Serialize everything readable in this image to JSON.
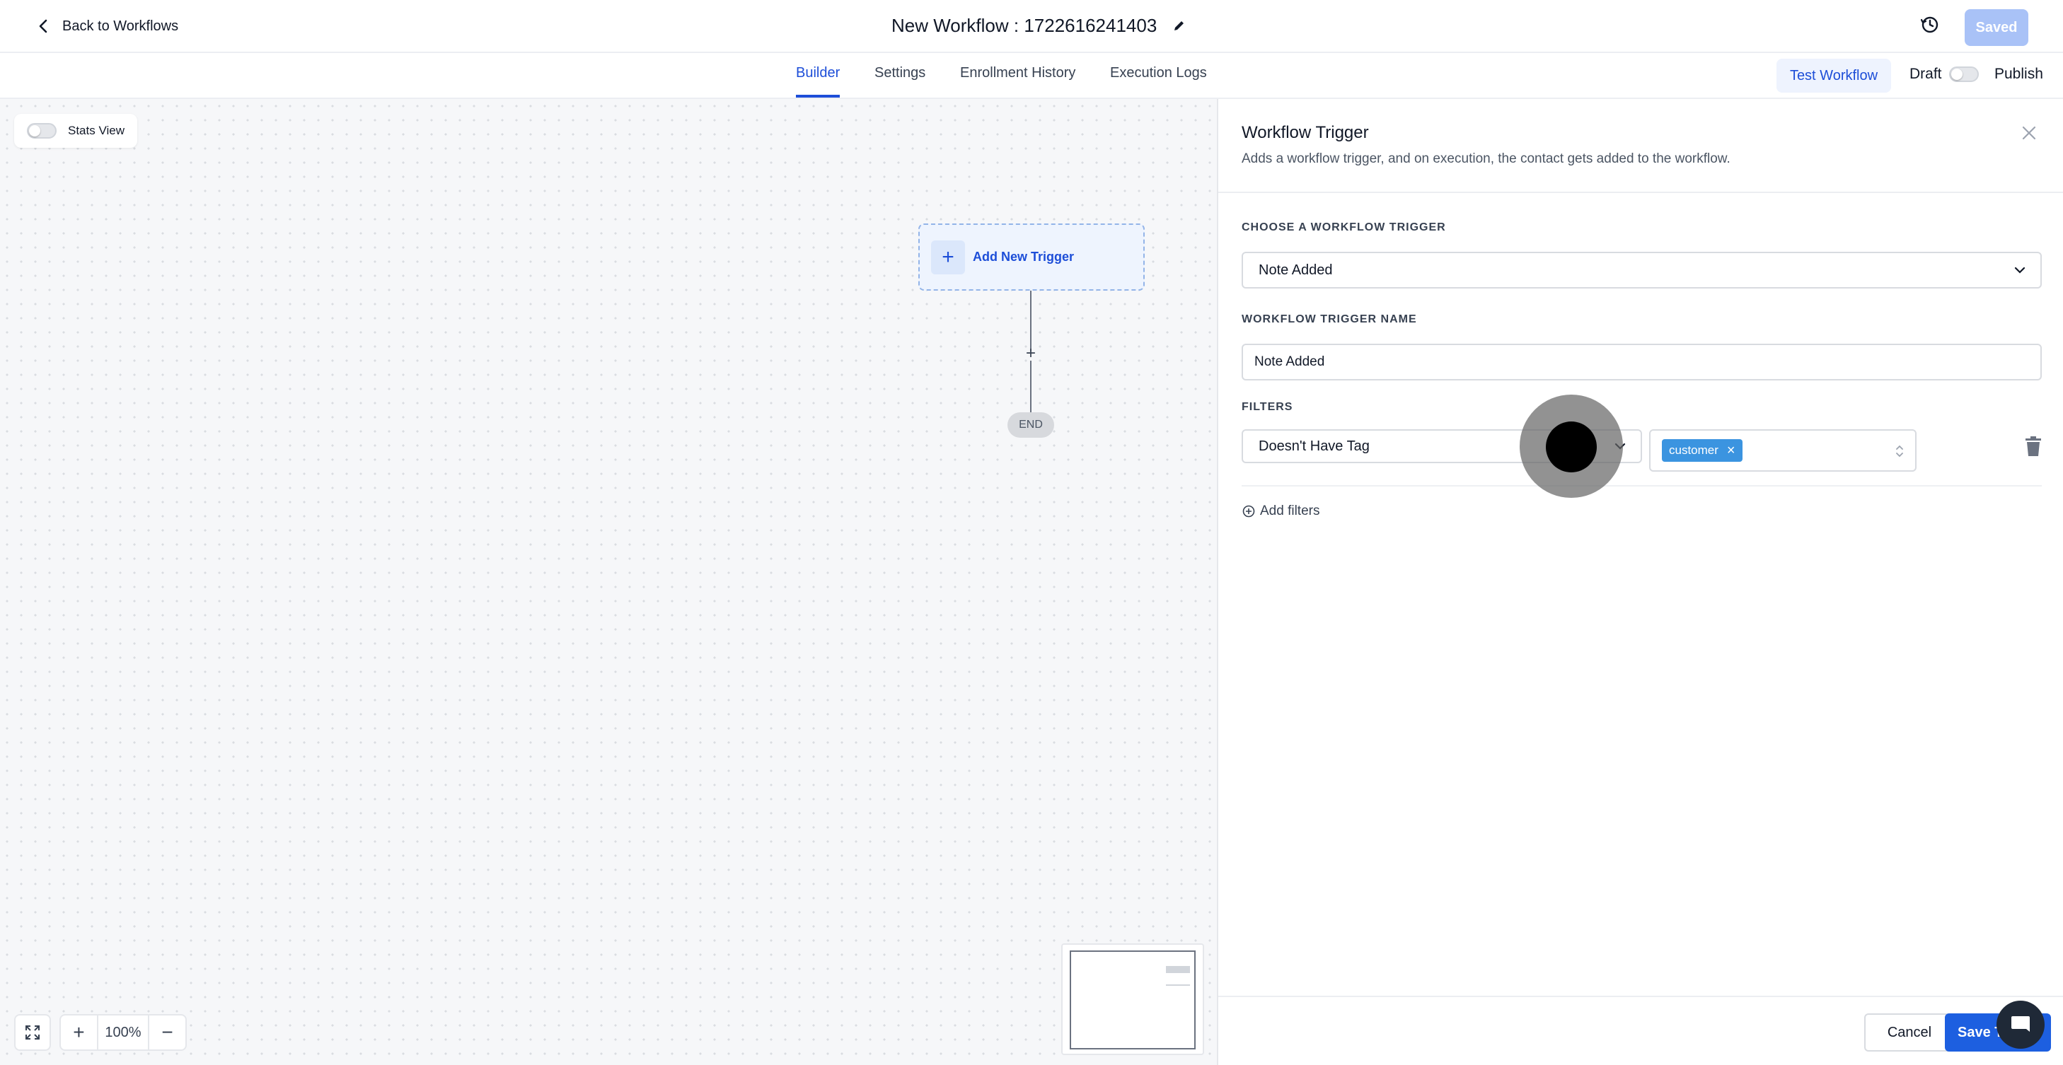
{
  "header": {
    "back_label": "Back to Workflows",
    "title": "New Workflow : 1722616241403",
    "saved_label": "Saved"
  },
  "tabs": [
    {
      "label": "Builder",
      "active": true
    },
    {
      "label": "Settings",
      "active": false
    },
    {
      "label": "Enrollment History",
      "active": false
    },
    {
      "label": "Execution Logs",
      "active": false
    }
  ],
  "actions": {
    "test_label": "Test Workflow",
    "draft_label": "Draft",
    "publish_label": "Publish",
    "publish_on": false
  },
  "canvas": {
    "stats_view_label": "Stats View",
    "stats_view_on": false,
    "add_trigger_label": "Add New Trigger",
    "add_step_symbol": "+",
    "end_label": "END",
    "zoom_level": "100%",
    "zoom_in_symbol": "+",
    "zoom_out_symbol": "−"
  },
  "panel": {
    "title": "Workflow Trigger",
    "description": "Adds a workflow trigger, and on execution, the contact gets added to the workflow.",
    "choose_trigger_label": "CHOOSE A WORKFLOW TRIGGER",
    "selected_trigger": "Note Added",
    "trigger_name_label": "WORKFLOW TRIGGER NAME",
    "trigger_name_value": "Note Added",
    "filters_label": "FILTERS",
    "filter_condition": "Doesn't Have Tag",
    "filter_tags": [
      "customer"
    ],
    "tag_remove_symbol": "×",
    "add_filters_label": "Add filters",
    "cancel_label": "Cancel",
    "save_label": "Save Trigger"
  },
  "colors": {
    "accent": "#1d4ed8",
    "primary_button": "#1d5fe0",
    "saved_button": "#a9c2f7",
    "tag_chip": "#3b94e0",
    "trigger_node_bg": "#eef4fe"
  }
}
